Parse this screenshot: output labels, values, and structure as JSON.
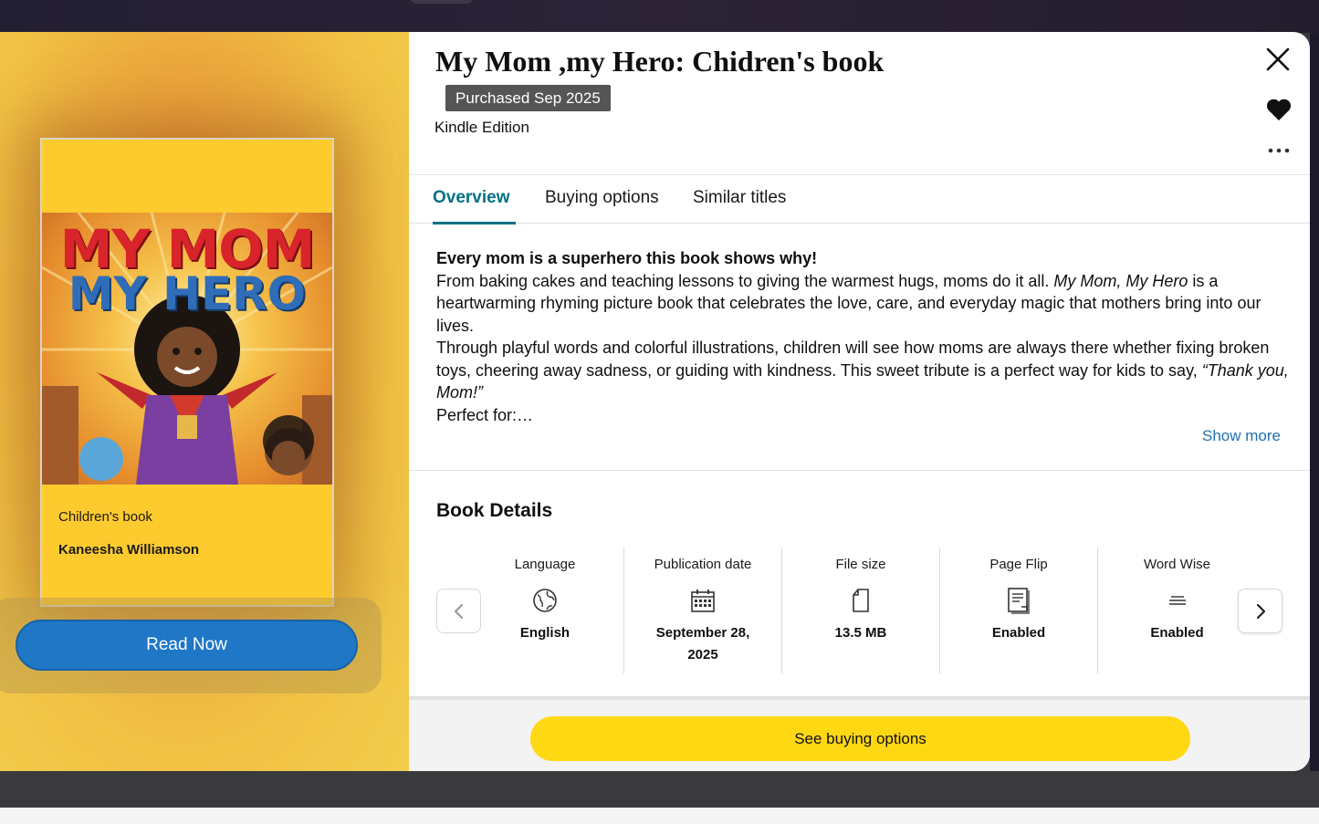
{
  "book": {
    "title": "My Mom ,my Hero: Chidren's book",
    "purchased_badge": "Purchased Sep 2025",
    "edition": "Kindle Edition"
  },
  "cover": {
    "title_line1": "MY MOM",
    "title_line2": "MY HERO",
    "label": "Children's book",
    "author": "Kaneesha Williamson"
  },
  "actions": {
    "read_now": "Read Now",
    "see_buying_options": "See buying options",
    "show_more": "Show more"
  },
  "icons": {
    "close": "close-icon",
    "favorite": "heart-icon",
    "more": "more-options-icon"
  },
  "tabs": [
    {
      "label": "Overview",
      "active": true
    },
    {
      "label": "Buying options",
      "active": false
    },
    {
      "label": "Similar titles",
      "active": false
    }
  ],
  "description": {
    "headline": "Every mom is a superhero this book shows why!",
    "p1_part1": "From baking cakes and teaching lessons to giving the warmest hugs, moms do it all. ",
    "p1_italic": "My Mom, My Hero",
    "p1_part2": " is a heartwarming rhyming picture book that celebrates the love, care, and everyday magic that mothers bring into our lives.",
    "p2_part1": "Through playful words and colorful illustrations, children will see how moms are always there whether fixing broken toys, cheering away sadness, or guiding with kindness. This sweet tribute is a perfect way for kids to say, ",
    "p2_italic": "“Thank you, Mom!”",
    "p3": "Perfect for:…"
  },
  "details": {
    "title": "Book Details",
    "items": [
      {
        "label": "Language",
        "value": "English",
        "icon": "globe-icon"
      },
      {
        "label": "Publication date",
        "value": "September 28, 2025",
        "icon": "calendar-icon"
      },
      {
        "label": "File size",
        "value": "13.5 MB",
        "icon": "file-icon"
      },
      {
        "label": "Page Flip",
        "value": "Enabled",
        "icon": "page-flip-icon"
      },
      {
        "label": "Word Wise",
        "value": "Enabled",
        "icon": "word-wise-icon"
      }
    ]
  },
  "colors": {
    "teal_active": "#007185",
    "read_button": "#1f77c6",
    "buy_button": "#ffd814",
    "link_blue": "#1f6fb2",
    "cover_yellow": "#fecb2f"
  }
}
